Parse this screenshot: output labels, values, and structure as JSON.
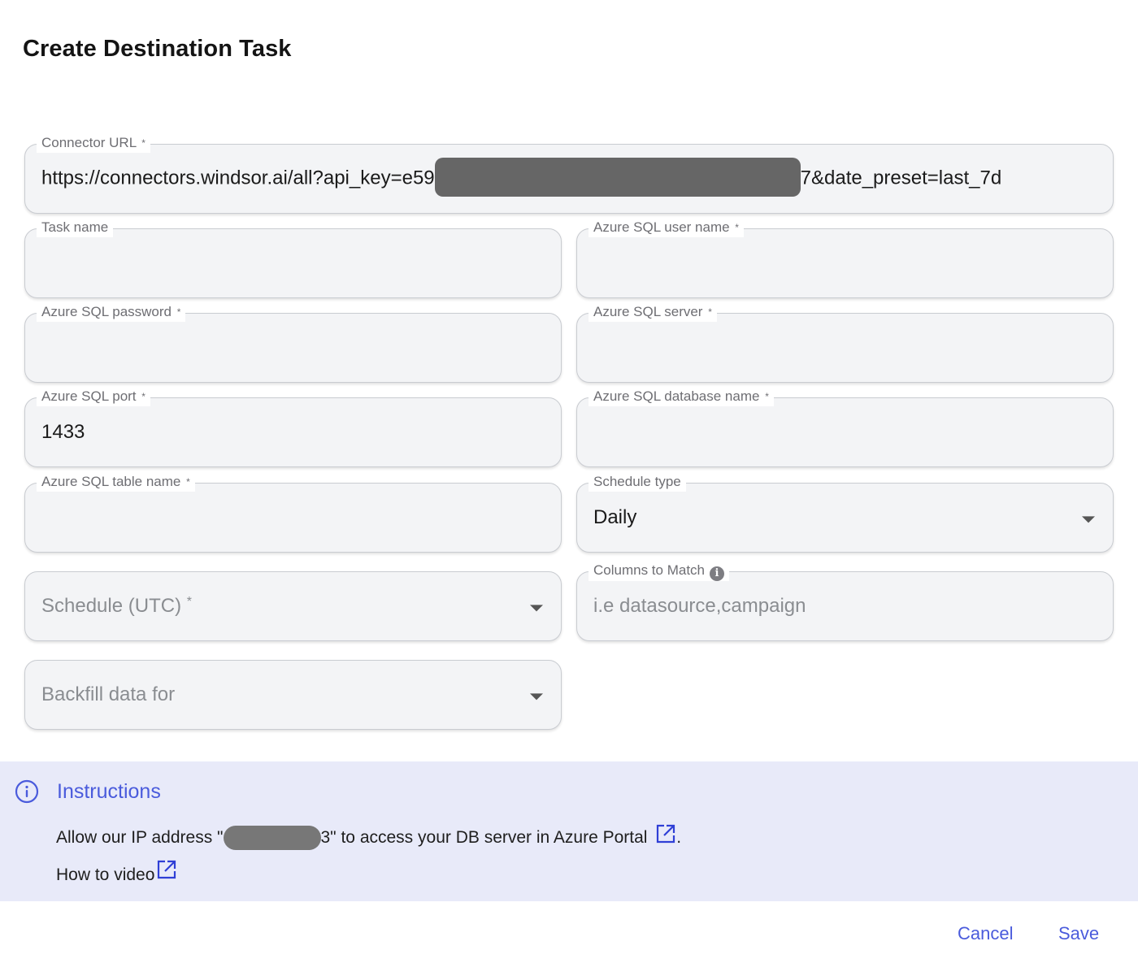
{
  "dialog": {
    "title": "Create Destination Task"
  },
  "fields": {
    "connector_url": {
      "label": "Connector URL",
      "required": "*",
      "value_prefix": "https://connectors.windsor.ai/all?api_key=e59",
      "value_suffix": "7&date_preset=last_7d"
    },
    "task_name": {
      "label": "Task name",
      "value": ""
    },
    "azure_sql_user_name": {
      "label": "Azure SQL user name",
      "required": "*",
      "value": ""
    },
    "azure_sql_password": {
      "label": "Azure SQL password",
      "required": "*",
      "value": ""
    },
    "azure_sql_server": {
      "label": "Azure SQL server",
      "required": "*",
      "value": ""
    },
    "azure_sql_port": {
      "label": "Azure SQL port",
      "required": "*",
      "value": "1433"
    },
    "azure_sql_database_name": {
      "label": "Azure SQL database name",
      "required": "*",
      "value": ""
    },
    "azure_sql_table_name": {
      "label": "Azure SQL table name",
      "required": "*",
      "value": ""
    },
    "schedule_type": {
      "label": "Schedule type",
      "value": "Daily"
    },
    "schedule_utc": {
      "placeholder": "Schedule (UTC)",
      "required": "*"
    },
    "columns_to_match": {
      "label": "Columns to Match",
      "placeholder": "i.e datasource,campaign",
      "info_icon": "i"
    },
    "backfill": {
      "placeholder": "Backfill data for"
    }
  },
  "instructions": {
    "title": "Instructions",
    "ip_prefix": "Allow our IP address \"",
    "ip_suffix": "3\" to access your DB server in Azure Portal",
    "ip_end": ".",
    "video_label": "How to video"
  },
  "actions": {
    "cancel": "Cancel",
    "save": "Save"
  },
  "colors": {
    "accent": "#4a5bdc",
    "instructions_bg": "#e8eaf9",
    "field_bg": "#f3f4f6"
  },
  "icons": {
    "info": "info-circle-icon",
    "external": "external-link-icon",
    "dropdown": "chevron-down-icon"
  }
}
